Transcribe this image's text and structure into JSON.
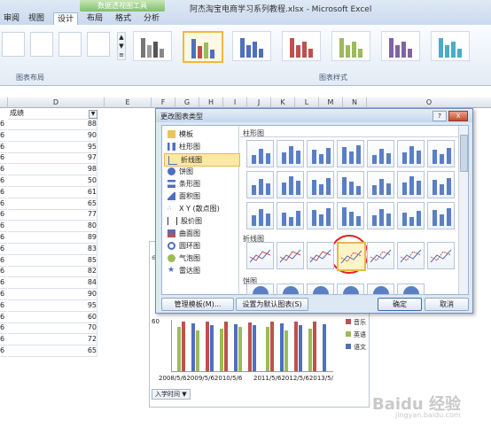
{
  "window_title": "阿杰淘宝电商学习系列教程.xlsx - Microsoft Excel",
  "ribbon": {
    "tabs": [
      "审阅",
      "视图",
      "设计",
      "布局",
      "格式",
      "分析"
    ],
    "active_tab": "设计",
    "context_label": "数据透视图工具",
    "group_chart_layout": "图表布局",
    "group_chart_styles": "图表样式"
  },
  "sheet": {
    "columns": [
      "D",
      "E",
      "F",
      "G",
      "H",
      "I",
      "J",
      "K",
      "L",
      "M",
      "N",
      "O"
    ],
    "header_cell": "成绩",
    "row_prefix": [
      "6",
      "6",
      "6",
      "6",
      "6",
      "6",
      "6",
      "6",
      "6",
      "6",
      "6",
      "6",
      "6",
      "6",
      "6",
      "6",
      "6",
      "6",
      "6",
      "6",
      "6",
      "6",
      "6",
      "6"
    ],
    "scores": [
      88,
      90,
      95,
      97,
      98,
      50,
      61,
      65,
      77,
      80,
      89,
      83,
      85,
      82,
      84,
      90,
      95,
      60,
      70,
      72,
      65
    ]
  },
  "dialog": {
    "title": "更改图表类型",
    "help": "?",
    "close": "X",
    "categories": [
      "模板",
      "柱形图",
      "折线图",
      "饼图",
      "条形图",
      "面积图",
      "X Y (散点图)",
      "股价图",
      "曲面图",
      "圆环图",
      "气泡图",
      "雷达图"
    ],
    "selected_category": "折线图",
    "section_column": "柱形图",
    "section_line": "折线图",
    "section_pie": "饼图",
    "btn_manage": "管理模板(M)...",
    "btn_default": "设置为默认图表(S)",
    "btn_ok": "确定",
    "btn_cancel": "取消"
  },
  "chart": {
    "y_tick": "60",
    "x_labels": [
      "2008/5/6",
      "2009/5/6",
      "2010/5/6",
      "2011/5/6",
      "2012/5/6",
      "2013/5/6"
    ],
    "legend": [
      "音乐",
      "英语",
      "语文"
    ],
    "filter_label": "入学时间"
  },
  "watermark": "Baidu 经验",
  "watermark_url": "jingyan.baidu.com",
  "colors": {
    "ctx_green": "#7fbf6a",
    "series_music": "#4f6fbf",
    "series_english": "#c0504d",
    "series_chinese": "#9bbb59",
    "highlight": "#e02020"
  }
}
